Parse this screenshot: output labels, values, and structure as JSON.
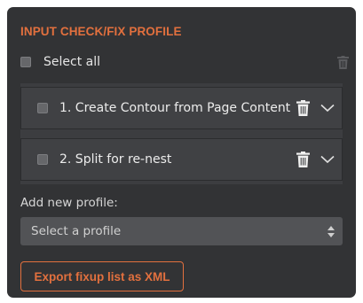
{
  "panel": {
    "title": "INPUT CHECK/FIX PROFILE",
    "select_all_label": "Select all",
    "select_all_checked": false,
    "delete_all_icon": "trash-icon"
  },
  "profiles": [
    {
      "label": "1. Create Contour from Page Content",
      "checked": false,
      "delete_icon": "trash-icon",
      "expand_icon": "chevron-down-icon"
    },
    {
      "label": "2. Split for re-nest",
      "checked": false,
      "delete_icon": "trash-icon",
      "expand_icon": "chevron-down-icon"
    }
  ],
  "add_profile": {
    "label": "Add new profile:",
    "select_value": "Select a profile",
    "select_icon": "updown-arrows-icon"
  },
  "export_button": {
    "label": "Export fixup list as XML"
  },
  "colors": {
    "accent": "#e2703e",
    "panel_bg": "#323335",
    "row_bg": "#404144",
    "select_bg": "#525356",
    "text": "#e6e6e6"
  }
}
